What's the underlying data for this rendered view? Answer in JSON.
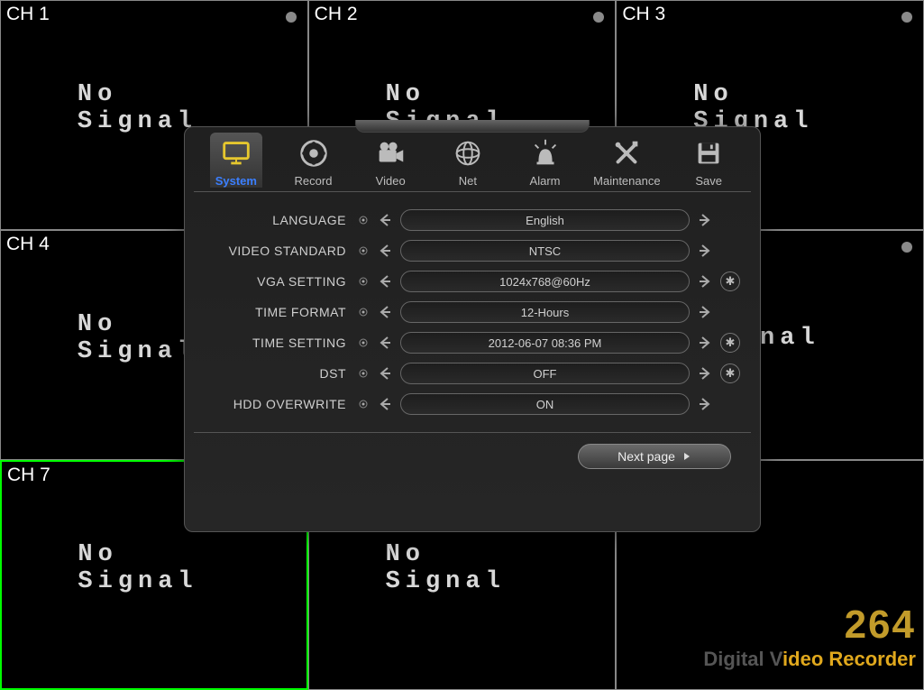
{
  "channels": [
    {
      "label": "CH 1",
      "status": "No Signal",
      "dot": true,
      "active": false
    },
    {
      "label": "CH 2",
      "status": "No Signal",
      "dot": true,
      "active": false
    },
    {
      "label": "CH 3",
      "status": "No Signal",
      "dot": true,
      "active": false
    },
    {
      "label": "CH 4",
      "status": "No Signal",
      "dot": false,
      "active": false
    },
    {
      "label": "",
      "status": "",
      "dot": false,
      "active": false
    },
    {
      "label": "",
      "status": "ignal",
      "dot": true,
      "active": false
    },
    {
      "label": "CH 7",
      "status": "No Signal",
      "dot": false,
      "active": true
    },
    {
      "label": "",
      "status": "No Signal",
      "dot": false,
      "active": false
    },
    {
      "label": "",
      "status": "",
      "dot": false,
      "active": false,
      "brand": true
    }
  ],
  "brand": {
    "big": "264",
    "small_gray": "Digital V",
    "small_yellow": "ideo Recorder"
  },
  "tabs": [
    {
      "id": "system",
      "label": "System",
      "active": true
    },
    {
      "id": "record",
      "label": "Record",
      "active": false
    },
    {
      "id": "video",
      "label": "Video",
      "active": false
    },
    {
      "id": "net",
      "label": "Net",
      "active": false
    },
    {
      "id": "alarm",
      "label": "Alarm",
      "active": false
    },
    {
      "id": "maintenance",
      "label": "Maintenance",
      "active": false
    },
    {
      "id": "save",
      "label": "Save",
      "active": false
    }
  ],
  "settings": [
    {
      "key": "language",
      "label": "LANGUAGE",
      "value": "English",
      "star": false
    },
    {
      "key": "video_standard",
      "label": "VIDEO STANDARD",
      "value": "NTSC",
      "star": false
    },
    {
      "key": "vga_setting",
      "label": "VGA SETTING",
      "value": "1024x768@60Hz",
      "star": true
    },
    {
      "key": "time_format",
      "label": "TIME FORMAT",
      "value": "12-Hours",
      "star": false
    },
    {
      "key": "time_setting",
      "label": "TIME SETTING",
      "value": "2012-06-07 08:36   PM",
      "star": true
    },
    {
      "key": "dst",
      "label": "DST",
      "value": "OFF",
      "star": true
    },
    {
      "key": "hdd_overwrite",
      "label": "HDD OVERWRITE",
      "value": "ON",
      "star": false
    }
  ],
  "next_label": "Next page"
}
